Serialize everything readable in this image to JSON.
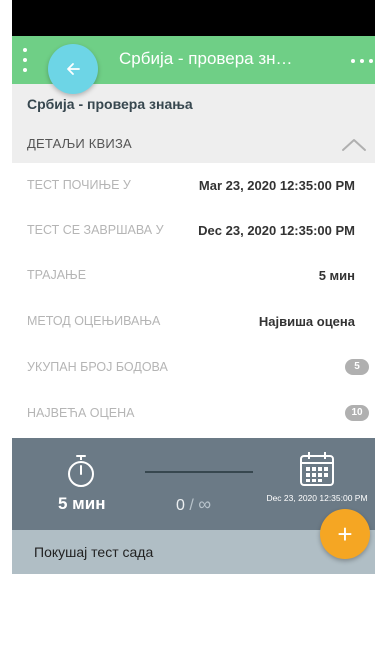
{
  "app_bar": {
    "title": "Србија - провера зн…",
    "background": "#6fcf86"
  },
  "back_fab": {
    "icon": "arrow-left-icon",
    "color": "#6dd5e6"
  },
  "quiz": {
    "name": "Србија - провера знања",
    "details_label": "ДЕТАЉИ КВИЗА",
    "collapse_icon": "chevron-up-icon"
  },
  "details": [
    {
      "label": "ТЕСТ ПОЧИЊЕ У",
      "value": "Mar 23, 2020 12:35:00 PM"
    },
    {
      "label": "ТЕСТ СЕ ЗАВРШАВА У",
      "value": "Dec 23, 2020 12:35:00 PM"
    },
    {
      "label": "ТРАЈАЊЕ",
      "value": "5 мин"
    },
    {
      "label": "МЕТОД ОЦЕЊИВАЊА",
      "value": "Највиша оцена"
    },
    {
      "label": "УКУПАН БРОЈ БОДОВА",
      "value": "5"
    },
    {
      "label": "НАЈВЕЋА ОЦЕНА",
      "value": "10"
    }
  ],
  "stats": {
    "duration": "5 мин",
    "attempts_used": "0",
    "separator": "/",
    "attempts_total": "∞",
    "end_date": "Dec 23, 2020 12:35:00 PM",
    "background": "#6b7a86"
  },
  "try_bar": {
    "label": "Покушај тест сада"
  },
  "add_fab": {
    "label": "+",
    "color": "#f5a623"
  }
}
